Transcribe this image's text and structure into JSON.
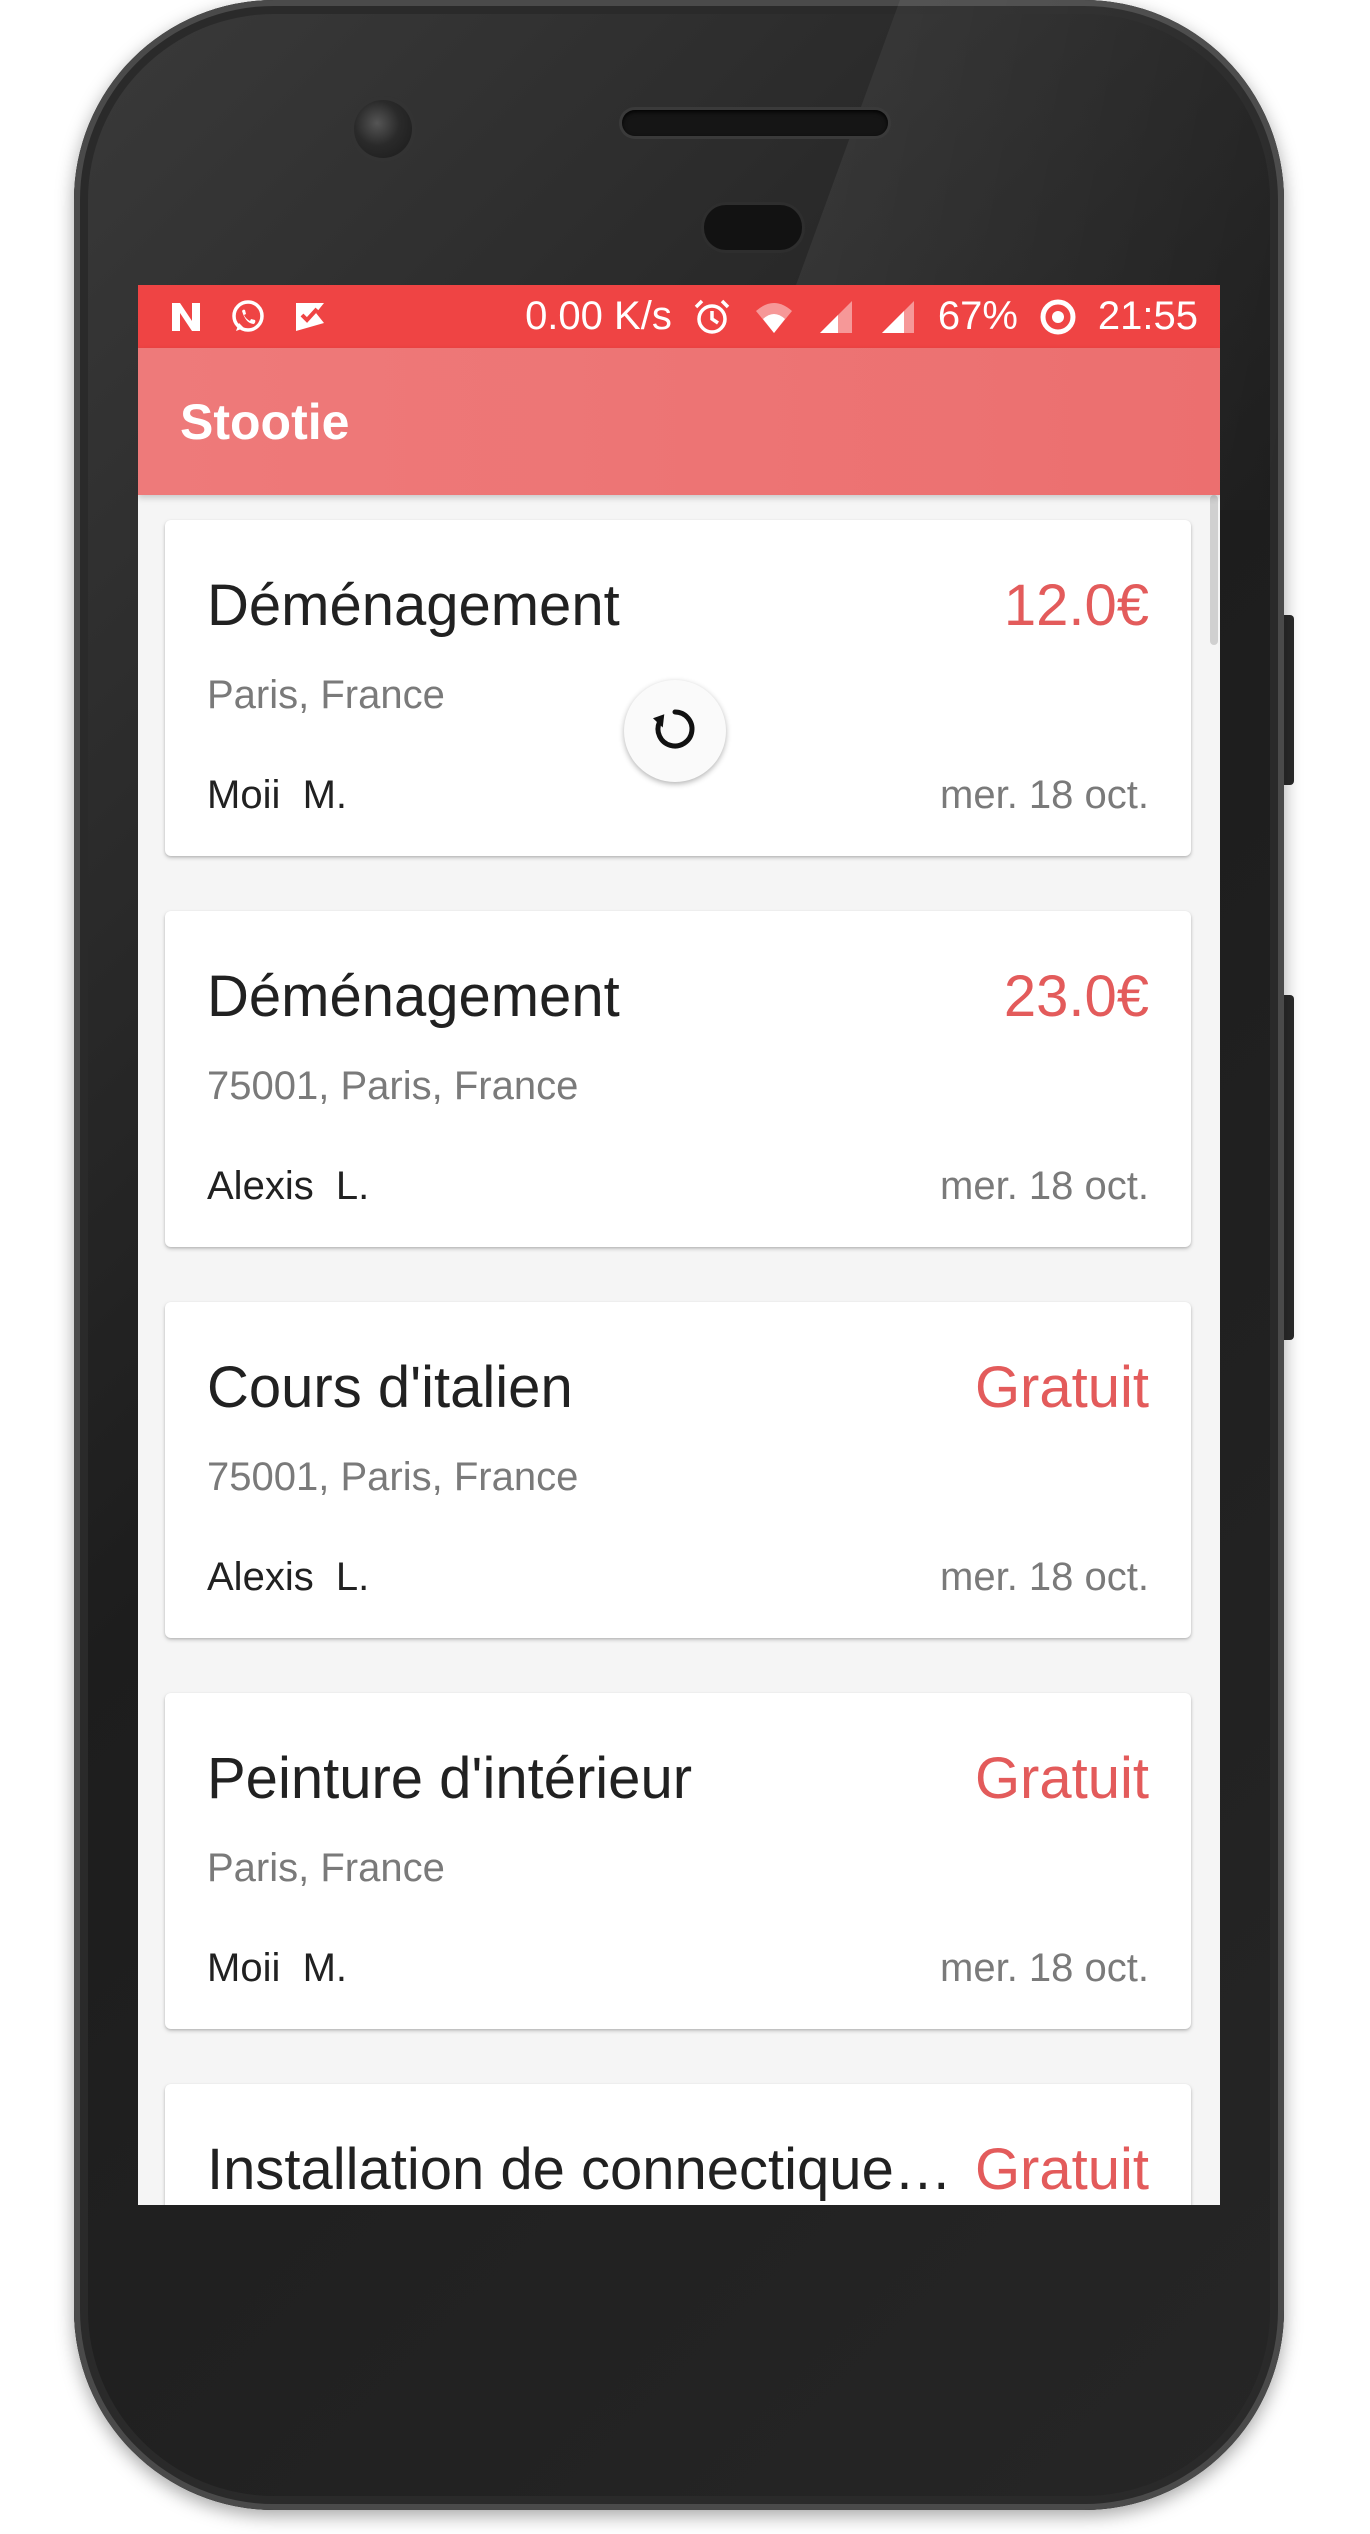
{
  "colors": {
    "status_bar": "#ef4444",
    "app_bar": "#ec6f6f",
    "price": "#e35b5b",
    "title_text": "#212121",
    "secondary_text": "#7a7a7a"
  },
  "status_bar": {
    "left_icons": [
      "n-notification-icon",
      "whatsapp-icon",
      "task-check-icon"
    ],
    "network_speed": "0.00 K/s",
    "right_icons": [
      "alarm-icon",
      "wifi-icon",
      "signal-icon",
      "signal-icon-2"
    ],
    "battery": "67%",
    "battery_icon": "battery-ring-icon",
    "time": "21:55"
  },
  "app_bar": {
    "title": "Stootie"
  },
  "refresh_indicator": {
    "icon": "refresh-icon"
  },
  "listings": [
    {
      "title": "Déménagement",
      "price": "12.0€",
      "location": "Paris, France",
      "user": "Moii  M.",
      "date": "mer. 18 oct."
    },
    {
      "title": "Déménagement",
      "price": "23.0€",
      "location": "75001, Paris, France",
      "user": "Alexis  L.",
      "date": "mer. 18 oct."
    },
    {
      "title": "Cours d'italien",
      "price": "Gratuit",
      "location": "75001, Paris, France",
      "user": "Alexis  L.",
      "date": "mer. 18 oct."
    },
    {
      "title": "Peinture d'intérieur",
      "price": "Gratuit",
      "location": "Paris, France",
      "user": "Moii  M.",
      "date": "mer. 18 oct."
    },
    {
      "title": "Installation de connectique…",
      "price": "Gratuit",
      "location": "",
      "user": "",
      "date": ""
    }
  ]
}
